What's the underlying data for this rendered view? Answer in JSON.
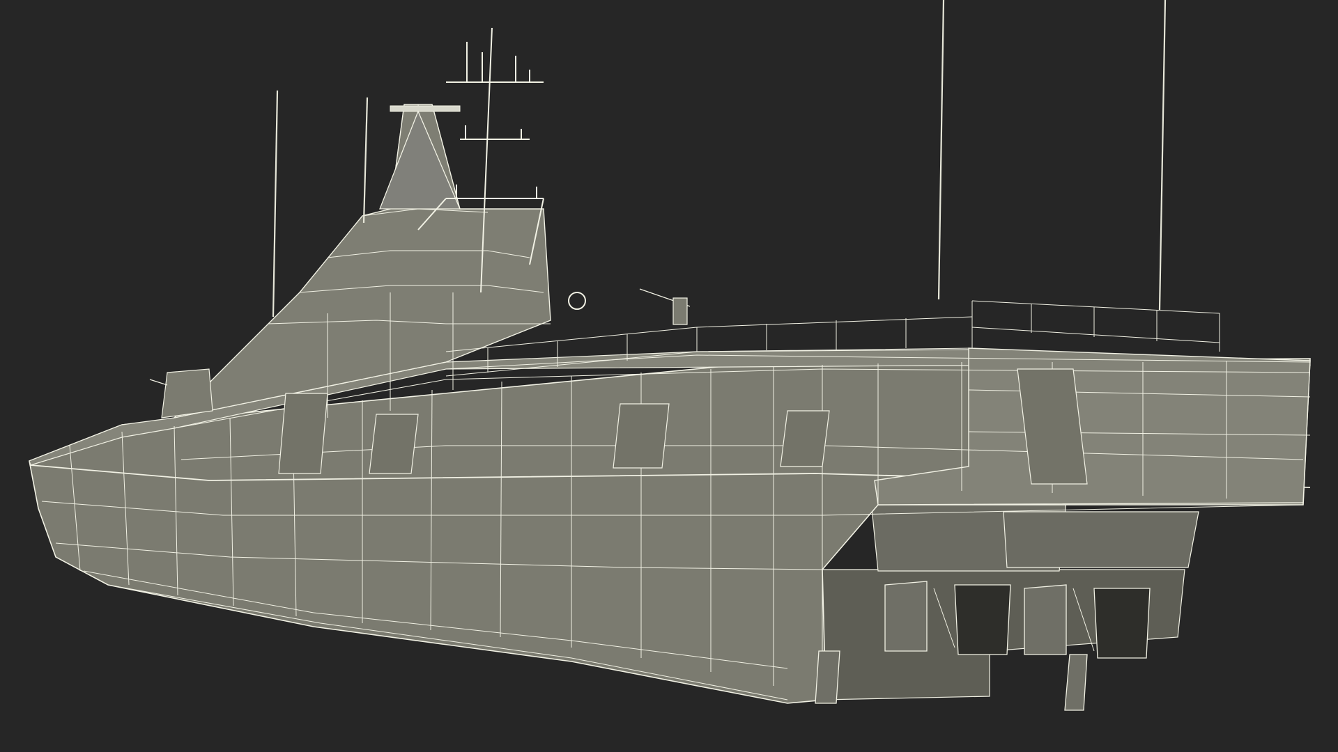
{
  "scene": {
    "background_color": "#262626",
    "hull_fill": "#7b7b70",
    "hull_shadow": "#5e5e55",
    "wire_color": "#f1f1e4",
    "dark_interior": "#2e2e2a"
  }
}
